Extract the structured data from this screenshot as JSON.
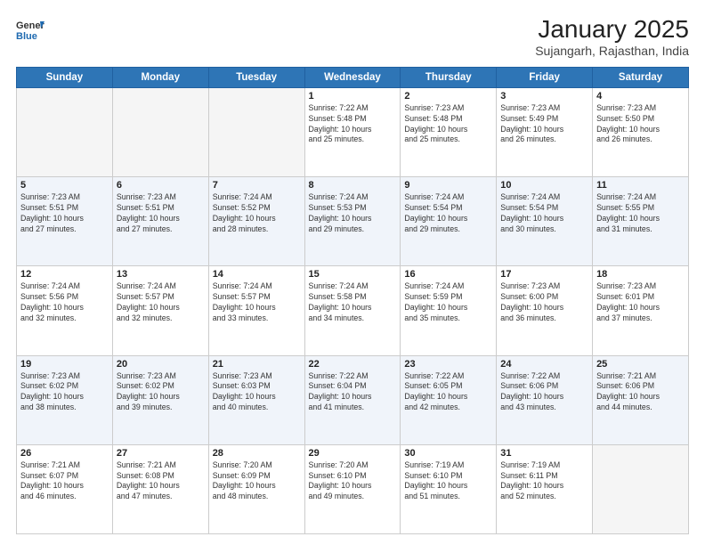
{
  "header": {
    "logo_line1": "General",
    "logo_line2": "Blue",
    "title": "January 2025",
    "subtitle": "Sujangarh, Rajasthan, India"
  },
  "weekdays": [
    "Sunday",
    "Monday",
    "Tuesday",
    "Wednesday",
    "Thursday",
    "Friday",
    "Saturday"
  ],
  "weeks": [
    [
      {
        "day": "",
        "info": ""
      },
      {
        "day": "",
        "info": ""
      },
      {
        "day": "",
        "info": ""
      },
      {
        "day": "1",
        "info": "Sunrise: 7:22 AM\nSunset: 5:48 PM\nDaylight: 10 hours\nand 25 minutes."
      },
      {
        "day": "2",
        "info": "Sunrise: 7:23 AM\nSunset: 5:48 PM\nDaylight: 10 hours\nand 25 minutes."
      },
      {
        "day": "3",
        "info": "Sunrise: 7:23 AM\nSunset: 5:49 PM\nDaylight: 10 hours\nand 26 minutes."
      },
      {
        "day": "4",
        "info": "Sunrise: 7:23 AM\nSunset: 5:50 PM\nDaylight: 10 hours\nand 26 minutes."
      }
    ],
    [
      {
        "day": "5",
        "info": "Sunrise: 7:23 AM\nSunset: 5:51 PM\nDaylight: 10 hours\nand 27 minutes."
      },
      {
        "day": "6",
        "info": "Sunrise: 7:23 AM\nSunset: 5:51 PM\nDaylight: 10 hours\nand 27 minutes."
      },
      {
        "day": "7",
        "info": "Sunrise: 7:24 AM\nSunset: 5:52 PM\nDaylight: 10 hours\nand 28 minutes."
      },
      {
        "day": "8",
        "info": "Sunrise: 7:24 AM\nSunset: 5:53 PM\nDaylight: 10 hours\nand 29 minutes."
      },
      {
        "day": "9",
        "info": "Sunrise: 7:24 AM\nSunset: 5:54 PM\nDaylight: 10 hours\nand 29 minutes."
      },
      {
        "day": "10",
        "info": "Sunrise: 7:24 AM\nSunset: 5:54 PM\nDaylight: 10 hours\nand 30 minutes."
      },
      {
        "day": "11",
        "info": "Sunrise: 7:24 AM\nSunset: 5:55 PM\nDaylight: 10 hours\nand 31 minutes."
      }
    ],
    [
      {
        "day": "12",
        "info": "Sunrise: 7:24 AM\nSunset: 5:56 PM\nDaylight: 10 hours\nand 32 minutes."
      },
      {
        "day": "13",
        "info": "Sunrise: 7:24 AM\nSunset: 5:57 PM\nDaylight: 10 hours\nand 32 minutes."
      },
      {
        "day": "14",
        "info": "Sunrise: 7:24 AM\nSunset: 5:57 PM\nDaylight: 10 hours\nand 33 minutes."
      },
      {
        "day": "15",
        "info": "Sunrise: 7:24 AM\nSunset: 5:58 PM\nDaylight: 10 hours\nand 34 minutes."
      },
      {
        "day": "16",
        "info": "Sunrise: 7:24 AM\nSunset: 5:59 PM\nDaylight: 10 hours\nand 35 minutes."
      },
      {
        "day": "17",
        "info": "Sunrise: 7:23 AM\nSunset: 6:00 PM\nDaylight: 10 hours\nand 36 minutes."
      },
      {
        "day": "18",
        "info": "Sunrise: 7:23 AM\nSunset: 6:01 PM\nDaylight: 10 hours\nand 37 minutes."
      }
    ],
    [
      {
        "day": "19",
        "info": "Sunrise: 7:23 AM\nSunset: 6:02 PM\nDaylight: 10 hours\nand 38 minutes."
      },
      {
        "day": "20",
        "info": "Sunrise: 7:23 AM\nSunset: 6:02 PM\nDaylight: 10 hours\nand 39 minutes."
      },
      {
        "day": "21",
        "info": "Sunrise: 7:23 AM\nSunset: 6:03 PM\nDaylight: 10 hours\nand 40 minutes."
      },
      {
        "day": "22",
        "info": "Sunrise: 7:22 AM\nSunset: 6:04 PM\nDaylight: 10 hours\nand 41 minutes."
      },
      {
        "day": "23",
        "info": "Sunrise: 7:22 AM\nSunset: 6:05 PM\nDaylight: 10 hours\nand 42 minutes."
      },
      {
        "day": "24",
        "info": "Sunrise: 7:22 AM\nSunset: 6:06 PM\nDaylight: 10 hours\nand 43 minutes."
      },
      {
        "day": "25",
        "info": "Sunrise: 7:21 AM\nSunset: 6:06 PM\nDaylight: 10 hours\nand 44 minutes."
      }
    ],
    [
      {
        "day": "26",
        "info": "Sunrise: 7:21 AM\nSunset: 6:07 PM\nDaylight: 10 hours\nand 46 minutes."
      },
      {
        "day": "27",
        "info": "Sunrise: 7:21 AM\nSunset: 6:08 PM\nDaylight: 10 hours\nand 47 minutes."
      },
      {
        "day": "28",
        "info": "Sunrise: 7:20 AM\nSunset: 6:09 PM\nDaylight: 10 hours\nand 48 minutes."
      },
      {
        "day": "29",
        "info": "Sunrise: 7:20 AM\nSunset: 6:10 PM\nDaylight: 10 hours\nand 49 minutes."
      },
      {
        "day": "30",
        "info": "Sunrise: 7:19 AM\nSunset: 6:10 PM\nDaylight: 10 hours\nand 51 minutes."
      },
      {
        "day": "31",
        "info": "Sunrise: 7:19 AM\nSunset: 6:11 PM\nDaylight: 10 hours\nand 52 minutes."
      },
      {
        "day": "",
        "info": ""
      }
    ]
  ]
}
